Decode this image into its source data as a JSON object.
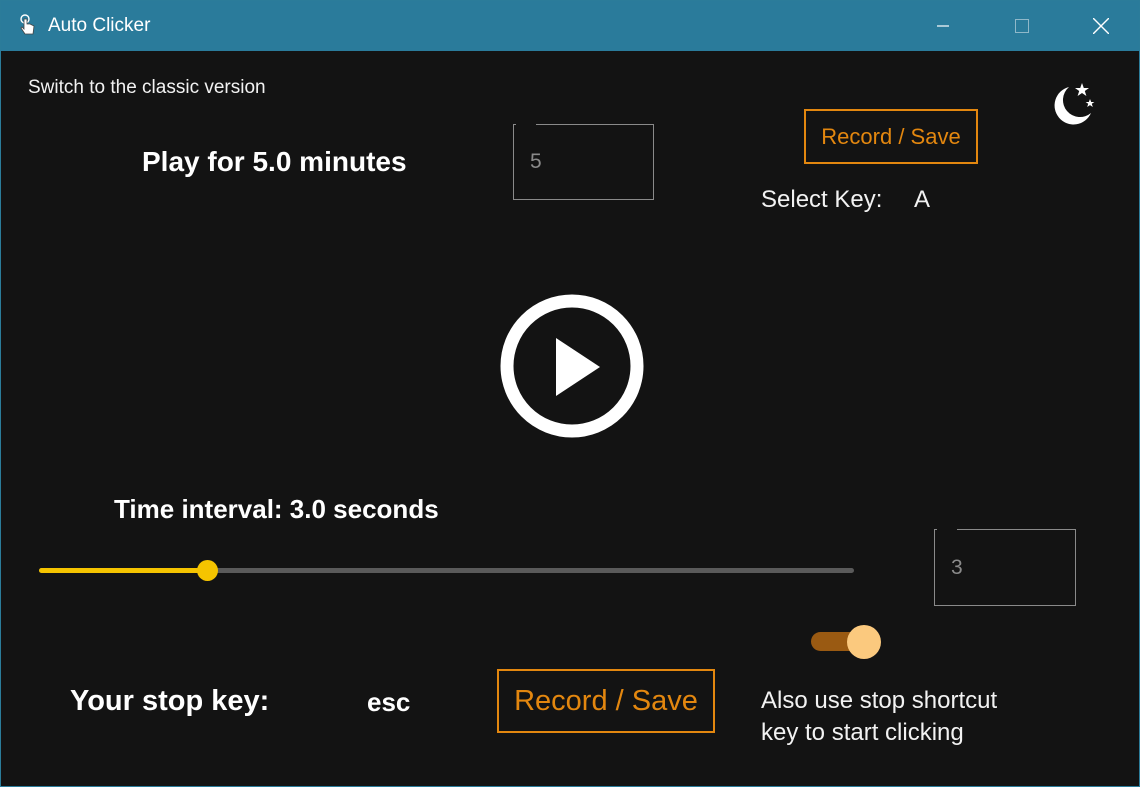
{
  "window": {
    "title": "Auto Clicker",
    "colors": {
      "titlebar": "#2a7b9b",
      "background": "#131313",
      "accent_orange": "#e3870f",
      "slider_yellow": "#f5c400",
      "toggle_on": "#fbc97e"
    },
    "controls": {
      "minimize_icon": "minimize-icon",
      "maximize_icon": "maximize-icon",
      "close_icon": "close-icon"
    }
  },
  "header": {
    "classic_link": "Switch to the classic version",
    "theme_icon": "moon-stars-icon"
  },
  "duration": {
    "label": "Play for 5.0 minutes",
    "input_value": "5",
    "unit": "minutes"
  },
  "key_select": {
    "record_label": "Record / Save",
    "select_label": "Select Key:",
    "selected_key": "A"
  },
  "play": {
    "icon": "play-circle-icon"
  },
  "interval": {
    "label": "Time interval: 3.0 seconds",
    "slider_fraction": 0.206,
    "input_value": "3"
  },
  "stop": {
    "label": "Your stop key:",
    "key": "esc",
    "record_label": "Record / Save"
  },
  "shortcut": {
    "toggle_on": true,
    "label_line1": "Also use stop shortcut",
    "label_line2": "key to start clicking"
  }
}
